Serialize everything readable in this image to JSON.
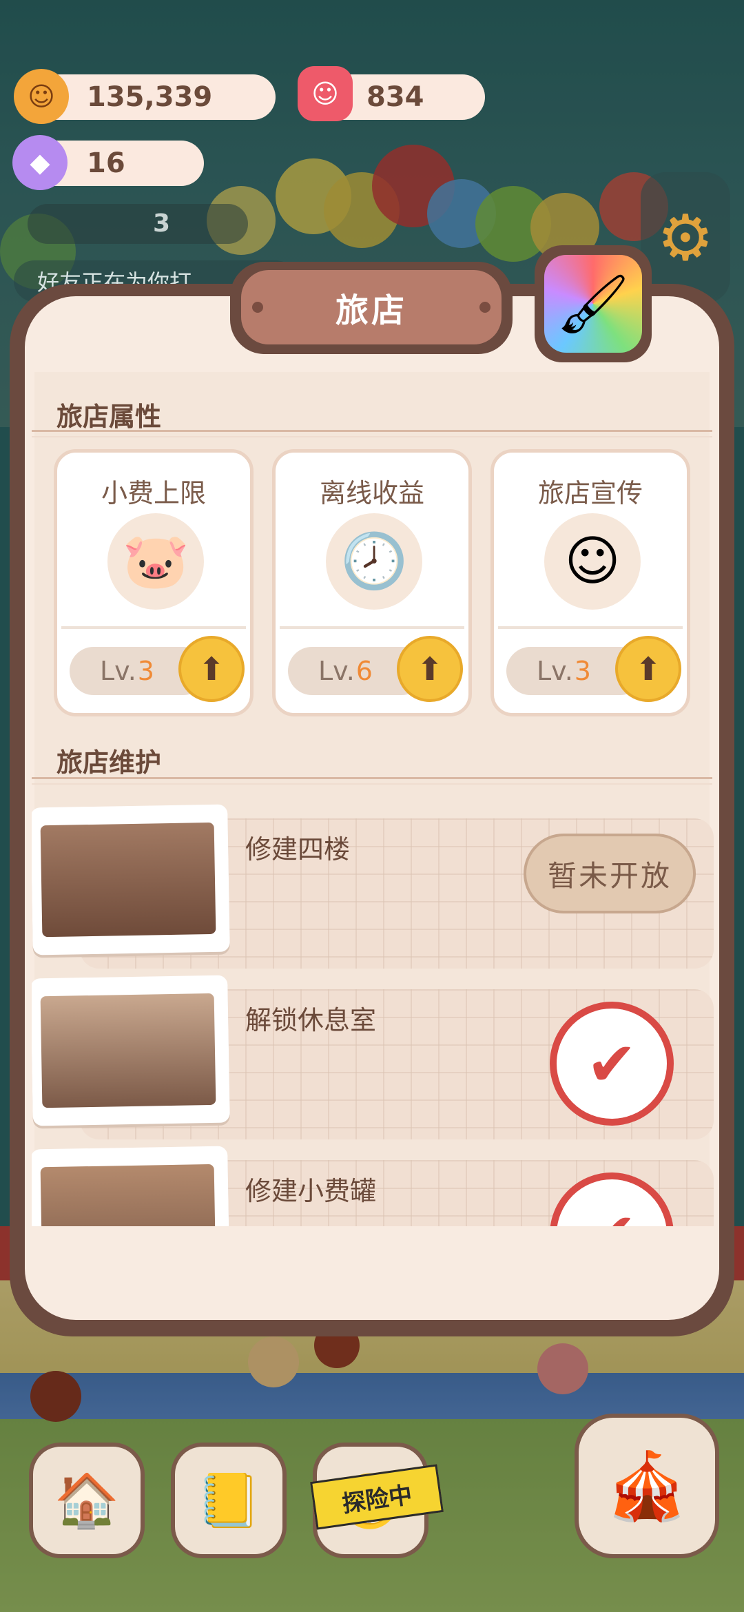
{
  "resources": {
    "cookies": "135,339",
    "candles": "834",
    "candy": "16"
  },
  "notice": {
    "count": "3",
    "text": "好友正在为你打"
  },
  "panel": {
    "title": "旅店"
  },
  "attributes": {
    "section_title": "旅店属性",
    "cards": [
      {
        "name": "小费上限",
        "lv_prefix": "Lv.",
        "level": "3",
        "icon": "piggy-bank-icon"
      },
      {
        "name": "离线收益",
        "lv_prefix": "Lv.",
        "level": "6",
        "icon": "clock-icon"
      },
      {
        "name": "旅店宣传",
        "lv_prefix": "Lv.",
        "level": "3",
        "icon": "mascots-icon"
      }
    ]
  },
  "maintenance": {
    "section_title": "旅店维护",
    "items": [
      {
        "title": "修建四楼",
        "status": "暂未开放"
      },
      {
        "title": "解锁休息室",
        "status": "done"
      },
      {
        "title": "修建小费罐",
        "status": "done"
      }
    ]
  },
  "bottom_nav": {
    "explore_label": "探险中"
  }
}
